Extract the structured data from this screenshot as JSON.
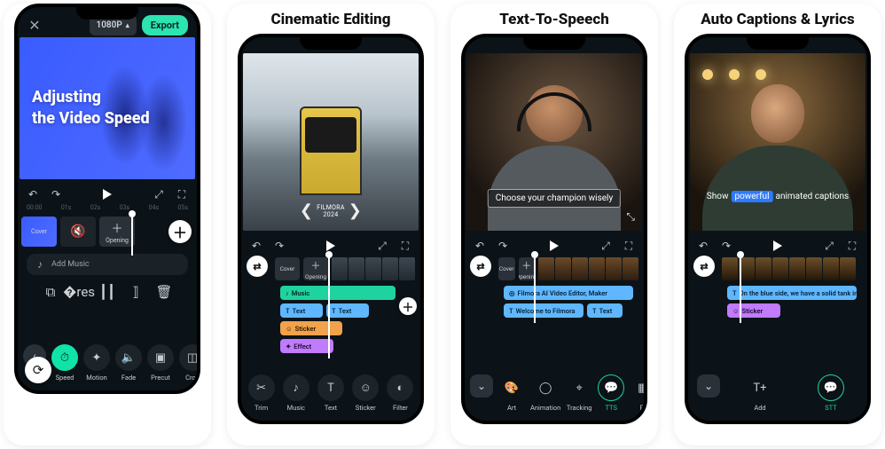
{
  "cards": {
    "a": {
      "resolution": "1080P",
      "export": "Export",
      "preview_line1": "Adjusting",
      "preview_line2": "the Video Speed",
      "timemarks": [
        "00:00",
        "01s",
        "02s",
        "03s",
        "04s",
        "05s"
      ],
      "cover": "Cover",
      "opening": "Opening",
      "add_music": "Add Music",
      "tools": [
        {
          "key": "speed",
          "label": "Speed",
          "active": true
        },
        {
          "key": "motion",
          "label": "Motion"
        },
        {
          "key": "fade",
          "label": "Fade"
        },
        {
          "key": "precut",
          "label": "Precut"
        },
        {
          "key": "crop",
          "label": "Crop"
        }
      ]
    },
    "b": {
      "title": "Cinematic Editing",
      "award_top": "FILMORA",
      "award_bottom": "2024",
      "cover": "Cover",
      "opening": "Opening",
      "music": "Music",
      "text": "Text",
      "sticker": "Sticker",
      "effect": "Effect",
      "tools": [
        {
          "key": "trim",
          "label": "Trim"
        },
        {
          "key": "music",
          "label": "Music"
        },
        {
          "key": "text",
          "label": "Text"
        },
        {
          "key": "sticker",
          "label": "Sticker"
        },
        {
          "key": "filter",
          "label": "Filter"
        }
      ]
    },
    "c": {
      "title": "Text-To-Speech",
      "caption": "Choose your champion wisely",
      "cover": "Cover",
      "opening": "Opening",
      "clip1": "Filmora AI Video Editor, Maker",
      "clip2": "Welcome to Filmora",
      "clip3": "Text",
      "tools": [
        {
          "key": "art",
          "label": "Art"
        },
        {
          "key": "animation",
          "label": "Animation"
        },
        {
          "key": "tracking",
          "label": "Tracking"
        },
        {
          "key": "tts",
          "label": "TTS",
          "outlined": true
        },
        {
          "key": "preset",
          "label": "Pr"
        }
      ]
    },
    "d": {
      "title": "Auto Captions & Lyrics",
      "cap_pre": "Show",
      "cap_hl": "powerful",
      "cap_post": "animated captions",
      "clip1": "On the blue side, we have a solid tank in the top",
      "sticker": "Sticker",
      "tools": [
        {
          "key": "add",
          "label": "Add"
        },
        {
          "key": "stt",
          "label": "STT",
          "outlined": true
        }
      ]
    }
  }
}
